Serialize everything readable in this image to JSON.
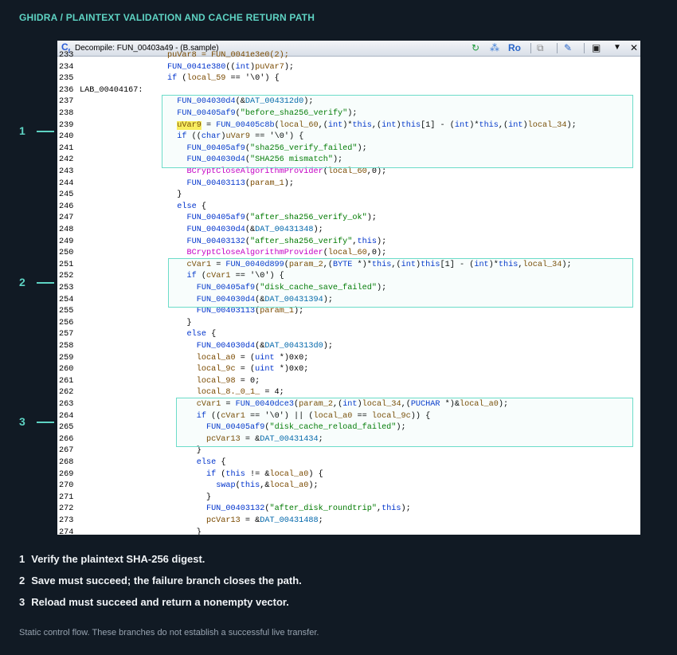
{
  "header": {
    "title": "GHIDRA / PLAINTEXT VALIDATION AND CACHE RETURN PATH"
  },
  "window": {
    "title": "Decompile: FUN_00403a49 -  (B.sample)",
    "toolbar": [
      {
        "icon": "refresh-icon",
        "label": "↻"
      },
      {
        "icon": "graph-icon",
        "label": "⁂"
      },
      {
        "icon": "read-only-toggle",
        "label": "Ro"
      },
      {
        "icon": "copy-icon",
        "label": "⧉"
      },
      {
        "icon": "edit-icon",
        "label": "✎"
      },
      {
        "icon": "snapshot-icon",
        "label": "▣"
      },
      {
        "icon": "menu-dropdown-icon",
        "label": "▼"
      },
      {
        "icon": "close-icon",
        "label": "✕"
      }
    ]
  },
  "code_lines": [
    {
      "n": "233",
      "t": [
        {
          "c": "",
          "s": "                  "
        },
        {
          "c": "t-var",
          "s": "puVar8 = FUN_0041e3e0(2);"
        }
      ]
    },
    {
      "n": "234",
      "t": [
        {
          "c": "",
          "s": "                  "
        },
        {
          "c": "t-func",
          "s": "FUN_0041e380"
        },
        {
          "c": "",
          "s": "(("
        },
        {
          "c": "t-type",
          "s": "int"
        },
        {
          "c": "",
          "s": ")"
        },
        {
          "c": "t-var",
          "s": "puVar7"
        },
        {
          "c": "",
          "s": ");"
        }
      ]
    },
    {
      "n": "235",
      "t": [
        {
          "c": "",
          "s": "                  "
        },
        {
          "c": "t-kw",
          "s": "if"
        },
        {
          "c": "",
          "s": " ("
        },
        {
          "c": "t-var",
          "s": "local_59"
        },
        {
          "c": "",
          "s": " == '\\0') {"
        }
      ]
    },
    {
      "n": "236",
      "t": [
        {
          "c": "",
          "s": "LAB_00404167:"
        }
      ]
    },
    {
      "n": "237",
      "t": [
        {
          "c": "",
          "s": "                    "
        },
        {
          "c": "t-func",
          "s": "FUN_004030d4"
        },
        {
          "c": "",
          "s": "(&"
        },
        {
          "c": "t-global",
          "s": "DAT_004312d0"
        },
        {
          "c": "",
          "s": ");"
        }
      ]
    },
    {
      "n": "238",
      "t": [
        {
          "c": "",
          "s": "                    "
        },
        {
          "c": "t-func",
          "s": "FUN_00405af9"
        },
        {
          "c": "",
          "s": "("
        },
        {
          "c": "t-str",
          "s": "\"before_sha256_verify\""
        },
        {
          "c": "",
          "s": ");"
        }
      ]
    },
    {
      "n": "239",
      "t": [
        {
          "c": "",
          "s": "                    "
        },
        {
          "c": "t-hl",
          "s": "uVar9"
        },
        {
          "c": "",
          "s": " = "
        },
        {
          "c": "t-func",
          "s": "FUN_00405c8b"
        },
        {
          "c": "",
          "s": "("
        },
        {
          "c": "t-var",
          "s": "local_60"
        },
        {
          "c": "",
          "s": ",("
        },
        {
          "c": "t-type",
          "s": "int"
        },
        {
          "c": "",
          "s": ")*"
        },
        {
          "c": "t-kw",
          "s": "this"
        },
        {
          "c": "",
          "s": ",("
        },
        {
          "c": "t-type",
          "s": "int"
        },
        {
          "c": "",
          "s": ")"
        },
        {
          "c": "t-kw",
          "s": "this"
        },
        {
          "c": "",
          "s": "[1] - ("
        },
        {
          "c": "t-type",
          "s": "int"
        },
        {
          "c": "",
          "s": ")*"
        },
        {
          "c": "t-kw",
          "s": "this"
        },
        {
          "c": "",
          "s": ",("
        },
        {
          "c": "t-type",
          "s": "int"
        },
        {
          "c": "",
          "s": ")"
        },
        {
          "c": "t-var",
          "s": "local_34"
        },
        {
          "c": "",
          "s": ");"
        }
      ]
    },
    {
      "n": "240",
      "t": [
        {
          "c": "",
          "s": "                    "
        },
        {
          "c": "t-kw",
          "s": "if"
        },
        {
          "c": "",
          "s": " (("
        },
        {
          "c": "t-type",
          "s": "char"
        },
        {
          "c": "",
          "s": ")"
        },
        {
          "c": "t-var",
          "s": "uVar9"
        },
        {
          "c": "",
          "s": " == '\\0') {"
        }
      ]
    },
    {
      "n": "241",
      "t": [
        {
          "c": "",
          "s": "                      "
        },
        {
          "c": "t-func",
          "s": "FUN_00405af9"
        },
        {
          "c": "",
          "s": "("
        },
        {
          "c": "t-str",
          "s": "\"sha256_verify_failed\""
        },
        {
          "c": "",
          "s": ");"
        }
      ]
    },
    {
      "n": "242",
      "t": [
        {
          "c": "",
          "s": "                      "
        },
        {
          "c": "t-func",
          "s": "FUN_004030d4"
        },
        {
          "c": "",
          "s": "("
        },
        {
          "c": "t-str",
          "s": "\"SHA256 mismatch\""
        },
        {
          "c": "",
          "s": ");"
        }
      ]
    },
    {
      "n": "243",
      "t": [
        {
          "c": "",
          "s": "                      "
        },
        {
          "c": "t-bad",
          "s": "BCryptCloseAlgorithmProvider"
        },
        {
          "c": "",
          "s": "("
        },
        {
          "c": "t-var",
          "s": "local_60"
        },
        {
          "c": "",
          "s": ",0);"
        }
      ]
    },
    {
      "n": "244",
      "t": [
        {
          "c": "",
          "s": "                      "
        },
        {
          "c": "t-func",
          "s": "FUN_00403113"
        },
        {
          "c": "",
          "s": "("
        },
        {
          "c": "t-var",
          "s": "param_1"
        },
        {
          "c": "",
          "s": ");"
        }
      ]
    },
    {
      "n": "245",
      "t": [
        {
          "c": "",
          "s": "                    }"
        }
      ]
    },
    {
      "n": "246",
      "t": [
        {
          "c": "",
          "s": "                    "
        },
        {
          "c": "t-kw",
          "s": "else"
        },
        {
          "c": "",
          "s": " {"
        }
      ]
    },
    {
      "n": "247",
      "t": [
        {
          "c": "",
          "s": "                      "
        },
        {
          "c": "t-func",
          "s": "FUN_00405af9"
        },
        {
          "c": "",
          "s": "("
        },
        {
          "c": "t-str",
          "s": "\"after_sha256_verify_ok\""
        },
        {
          "c": "",
          "s": ");"
        }
      ]
    },
    {
      "n": "248",
      "t": [
        {
          "c": "",
          "s": "                      "
        },
        {
          "c": "t-func",
          "s": "FUN_004030d4"
        },
        {
          "c": "",
          "s": "(&"
        },
        {
          "c": "t-global",
          "s": "DAT_00431348"
        },
        {
          "c": "",
          "s": ");"
        }
      ]
    },
    {
      "n": "249",
      "t": [
        {
          "c": "",
          "s": "                      "
        },
        {
          "c": "t-func",
          "s": "FUN_00403132"
        },
        {
          "c": "",
          "s": "("
        },
        {
          "c": "t-str",
          "s": "\"after_sha256_verify\""
        },
        {
          "c": "",
          "s": ","
        },
        {
          "c": "t-kw",
          "s": "this"
        },
        {
          "c": "",
          "s": ");"
        }
      ]
    },
    {
      "n": "250",
      "t": [
        {
          "c": "",
          "s": "                      "
        },
        {
          "c": "t-bad",
          "s": "BCryptCloseAlgorithmProvider"
        },
        {
          "c": "",
          "s": "("
        },
        {
          "c": "t-var",
          "s": "local_60"
        },
        {
          "c": "",
          "s": ",0);"
        }
      ]
    },
    {
      "n": "251",
      "t": [
        {
          "c": "",
          "s": "                      "
        },
        {
          "c": "t-var",
          "s": "cVar1"
        },
        {
          "c": "",
          "s": " = "
        },
        {
          "c": "t-func",
          "s": "FUN_0040d899"
        },
        {
          "c": "",
          "s": "("
        },
        {
          "c": "t-var",
          "s": "param_2"
        },
        {
          "c": "",
          "s": ",("
        },
        {
          "c": "t-type",
          "s": "BYTE"
        },
        {
          "c": "",
          "s": " *)*"
        },
        {
          "c": "t-kw",
          "s": "this"
        },
        {
          "c": "",
          "s": ",("
        },
        {
          "c": "t-type",
          "s": "int"
        },
        {
          "c": "",
          "s": ")"
        },
        {
          "c": "t-kw",
          "s": "this"
        },
        {
          "c": "",
          "s": "[1] - ("
        },
        {
          "c": "t-type",
          "s": "int"
        },
        {
          "c": "",
          "s": ")*"
        },
        {
          "c": "t-kw",
          "s": "this"
        },
        {
          "c": "",
          "s": ","
        },
        {
          "c": "t-var",
          "s": "local_34"
        },
        {
          "c": "",
          "s": ");"
        }
      ]
    },
    {
      "n": "252",
      "t": [
        {
          "c": "",
          "s": "                      "
        },
        {
          "c": "t-kw",
          "s": "if"
        },
        {
          "c": "",
          "s": " ("
        },
        {
          "c": "t-var",
          "s": "cVar1"
        },
        {
          "c": "",
          "s": " == '\\0') {"
        }
      ]
    },
    {
      "n": "253",
      "t": [
        {
          "c": "",
          "s": "                        "
        },
        {
          "c": "t-func",
          "s": "FUN_00405af9"
        },
        {
          "c": "",
          "s": "("
        },
        {
          "c": "t-str",
          "s": "\"disk_cache_save_failed\""
        },
        {
          "c": "",
          "s": ");"
        }
      ]
    },
    {
      "n": "254",
      "t": [
        {
          "c": "",
          "s": "                        "
        },
        {
          "c": "t-func",
          "s": "FUN_004030d4"
        },
        {
          "c": "",
          "s": "(&"
        },
        {
          "c": "t-global",
          "s": "DAT_00431394"
        },
        {
          "c": "",
          "s": ");"
        }
      ]
    },
    {
      "n": "255",
      "t": [
        {
          "c": "",
          "s": "                        "
        },
        {
          "c": "t-func",
          "s": "FUN_00403113"
        },
        {
          "c": "",
          "s": "("
        },
        {
          "c": "t-var",
          "s": "param_1"
        },
        {
          "c": "",
          "s": ");"
        }
      ]
    },
    {
      "n": "256",
      "t": [
        {
          "c": "",
          "s": "                      }"
        }
      ]
    },
    {
      "n": "257",
      "t": [
        {
          "c": "",
          "s": "                      "
        },
        {
          "c": "t-kw",
          "s": "else"
        },
        {
          "c": "",
          "s": " {"
        }
      ]
    },
    {
      "n": "258",
      "t": [
        {
          "c": "",
          "s": "                        "
        },
        {
          "c": "t-func",
          "s": "FUN_004030d4"
        },
        {
          "c": "",
          "s": "(&"
        },
        {
          "c": "t-global",
          "s": "DAT_004313d0"
        },
        {
          "c": "",
          "s": ");"
        }
      ]
    },
    {
      "n": "259",
      "t": [
        {
          "c": "",
          "s": "                        "
        },
        {
          "c": "t-var",
          "s": "local_a0"
        },
        {
          "c": "",
          "s": " = ("
        },
        {
          "c": "t-type",
          "s": "uint"
        },
        {
          "c": "",
          "s": " *)0x0;"
        }
      ]
    },
    {
      "n": "260",
      "t": [
        {
          "c": "",
          "s": "                        "
        },
        {
          "c": "t-var",
          "s": "local_9c"
        },
        {
          "c": "",
          "s": " = ("
        },
        {
          "c": "t-type",
          "s": "uint"
        },
        {
          "c": "",
          "s": " *)0x0;"
        }
      ]
    },
    {
      "n": "261",
      "t": [
        {
          "c": "",
          "s": "                        "
        },
        {
          "c": "t-var",
          "s": "local_98"
        },
        {
          "c": "",
          "s": " = 0;"
        }
      ]
    },
    {
      "n": "262",
      "t": [
        {
          "c": "",
          "s": "                        "
        },
        {
          "c": "t-var",
          "s": "local_8._0_1_"
        },
        {
          "c": "",
          "s": " = 4;"
        }
      ]
    },
    {
      "n": "263",
      "t": [
        {
          "c": "",
          "s": "                        "
        },
        {
          "c": "t-var",
          "s": "cVar1"
        },
        {
          "c": "",
          "s": " = "
        },
        {
          "c": "t-func",
          "s": "FUN_0040dce3"
        },
        {
          "c": "",
          "s": "("
        },
        {
          "c": "t-var",
          "s": "param_2"
        },
        {
          "c": "",
          "s": ",("
        },
        {
          "c": "t-type",
          "s": "int"
        },
        {
          "c": "",
          "s": ")"
        },
        {
          "c": "t-var",
          "s": "local_34"
        },
        {
          "c": "",
          "s": ",("
        },
        {
          "c": "t-type",
          "s": "PUCHAR"
        },
        {
          "c": "",
          "s": " *)&"
        },
        {
          "c": "t-var",
          "s": "local_a0"
        },
        {
          "c": "",
          "s": ");"
        }
      ]
    },
    {
      "n": "264",
      "t": [
        {
          "c": "",
          "s": "                        "
        },
        {
          "c": "t-kw",
          "s": "if"
        },
        {
          "c": "",
          "s": " (("
        },
        {
          "c": "t-var",
          "s": "cVar1"
        },
        {
          "c": "",
          "s": " == '\\0') || ("
        },
        {
          "c": "t-var",
          "s": "local_a0"
        },
        {
          "c": "",
          "s": " == "
        },
        {
          "c": "t-var",
          "s": "local_9c"
        },
        {
          "c": "",
          "s": ")) {"
        }
      ]
    },
    {
      "n": "265",
      "t": [
        {
          "c": "",
          "s": "                          "
        },
        {
          "c": "t-func",
          "s": "FUN_00405af9"
        },
        {
          "c": "",
          "s": "("
        },
        {
          "c": "t-str",
          "s": "\"disk_cache_reload_failed\""
        },
        {
          "c": "",
          "s": ");"
        }
      ]
    },
    {
      "n": "266",
      "t": [
        {
          "c": "",
          "s": "                          "
        },
        {
          "c": "t-var",
          "s": "pcVar13"
        },
        {
          "c": "",
          "s": " = &"
        },
        {
          "c": "t-global",
          "s": "DAT_00431434"
        },
        {
          "c": "",
          "s": ";"
        }
      ]
    },
    {
      "n": "267",
      "t": [
        {
          "c": "",
          "s": "                        }"
        }
      ]
    },
    {
      "n": "268",
      "t": [
        {
          "c": "",
          "s": "                        "
        },
        {
          "c": "t-kw",
          "s": "else"
        },
        {
          "c": "",
          "s": " {"
        }
      ]
    },
    {
      "n": "269",
      "t": [
        {
          "c": "",
          "s": "                          "
        },
        {
          "c": "t-kw",
          "s": "if"
        },
        {
          "c": "",
          "s": " ("
        },
        {
          "c": "t-kw",
          "s": "this"
        },
        {
          "c": "",
          "s": " != &"
        },
        {
          "c": "t-var",
          "s": "local_a0"
        },
        {
          "c": "",
          "s": ") {"
        }
      ]
    },
    {
      "n": "270",
      "t": [
        {
          "c": "",
          "s": "                            "
        },
        {
          "c": "t-func",
          "s": "swap"
        },
        {
          "c": "",
          "s": "("
        },
        {
          "c": "t-kw",
          "s": "this"
        },
        {
          "c": "",
          "s": ",&"
        },
        {
          "c": "t-var",
          "s": "local_a0"
        },
        {
          "c": "",
          "s": ");"
        }
      ]
    },
    {
      "n": "271",
      "t": [
        {
          "c": "",
          "s": "                          }"
        }
      ]
    },
    {
      "n": "272",
      "t": [
        {
          "c": "",
          "s": "                          "
        },
        {
          "c": "t-func",
          "s": "FUN_00403132"
        },
        {
          "c": "",
          "s": "("
        },
        {
          "c": "t-str",
          "s": "\"after_disk_roundtrip\""
        },
        {
          "c": "",
          "s": ","
        },
        {
          "c": "t-kw",
          "s": "this"
        },
        {
          "c": "",
          "s": ");"
        }
      ]
    },
    {
      "n": "273",
      "t": [
        {
          "c": "",
          "s": "                          "
        },
        {
          "c": "t-var",
          "s": "pcVar13"
        },
        {
          "c": "",
          "s": " = &"
        },
        {
          "c": "t-global",
          "s": "DAT_00431488"
        },
        {
          "c": "",
          "s": ";"
        }
      ]
    },
    {
      "n": "274",
      "t": [
        {
          "c": "",
          "s": "                        }"
        }
      ]
    }
  ],
  "annotations": [
    {
      "marker": "1",
      "start": 237,
      "end": 242,
      "text": "Verify the plaintext SHA-256 digest."
    },
    {
      "marker": "2",
      "start": 251,
      "end": 254,
      "text": "Save must succeed; the failure branch closes the path."
    },
    {
      "marker": "3",
      "start": 263,
      "end": 266,
      "text": "Reload must succeed and return a nonempty vector."
    }
  ],
  "footer": "Static control flow. These branches do not establish a successful live transfer."
}
